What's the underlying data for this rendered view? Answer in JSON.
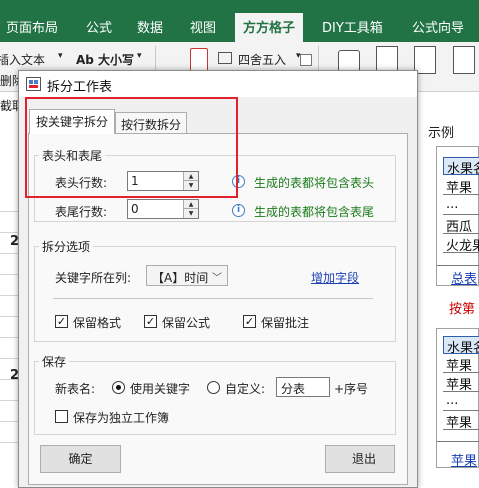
{
  "ribbon": {
    "tabs": [
      {
        "label": "页面布局",
        "active": false
      },
      {
        "label": "公式",
        "active": false
      },
      {
        "label": "数据",
        "active": false
      },
      {
        "label": "视图",
        "active": false
      },
      {
        "label": "方方格子",
        "active": true
      },
      {
        "label": "DIY工具箱",
        "active": false
      },
      {
        "label": "公式向导",
        "active": false
      }
    ],
    "items": {
      "insert_text": "插入文本",
      "size_case": "Ab 大小写",
      "round": "四舍五入",
      "delete": "删除",
      "extract": "截取"
    }
  },
  "sheet": {
    "row_marks": [
      "2",
      "2"
    ]
  },
  "dialog": {
    "title": "拆分工作表",
    "tabs": [
      {
        "label": "按关键字拆分",
        "active": true
      },
      {
        "label": "按行数拆分",
        "active": false
      }
    ],
    "header_footer": {
      "title": "表头和表尾",
      "header_rows_label": "表头行数:",
      "header_rows_value": "1",
      "header_hint": "生成的表都将包含表头",
      "footer_rows_label": "表尾行数:",
      "footer_rows_value": "0",
      "footer_hint": "生成的表都将包含表尾"
    },
    "split_options": {
      "title": "拆分选项",
      "key_column_label": "关键字所在列:",
      "key_column_value": "【A】时间",
      "add_field_link": "增加字段",
      "checkboxes": [
        {
          "label": "保留格式",
          "checked": true
        },
        {
          "label": "保留公式",
          "checked": true
        },
        {
          "label": "保留批注",
          "checked": true
        }
      ]
    },
    "save": {
      "title": "保存",
      "new_name_label": "新表名:",
      "use_key_label": "使用关键字",
      "use_key_selected": true,
      "custom_label": "自定义:",
      "custom_selected": false,
      "custom_value": "分表",
      "serial_suffix": "+序号",
      "save_as_workbook_label": "保存为独立工作簿",
      "save_as_workbook_checked": false
    },
    "buttons": {
      "ok": "确定",
      "exit": "退出"
    },
    "example": {
      "title": "示例",
      "top_cells": [
        "水果名",
        "苹果",
        "...",
        "西瓜",
        "火龙果"
      ],
      "top_footer": "总表",
      "caption": "按第",
      "bottom_cells": [
        "水果名",
        "苹果",
        "苹果",
        "...",
        "苹果"
      ],
      "bottom_footer": "苹果"
    }
  }
}
